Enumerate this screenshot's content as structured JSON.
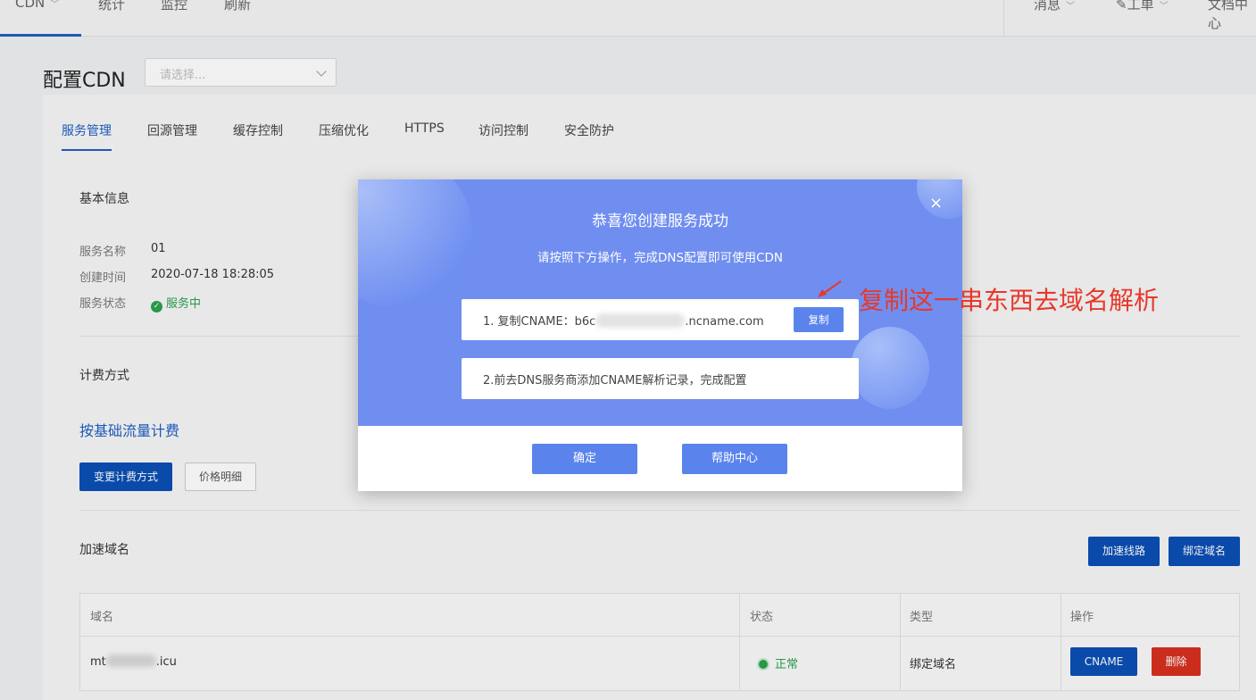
{
  "topnav": {
    "items": [
      "CDN",
      "统计",
      "监控",
      "刷新"
    ],
    "right_items": [
      "消息",
      "工单",
      "文档中心"
    ]
  },
  "header": {
    "title": "配置CDN",
    "select_placeholder": "请选择..."
  },
  "tabs": [
    "服务管理",
    "回源管理",
    "缓存控制",
    "压缩优化",
    "HTTPS",
    "访问控制",
    "安全防护"
  ],
  "basic_info": {
    "heading": "基本信息",
    "rows": [
      {
        "label": "服务名称",
        "value": "01"
      },
      {
        "label": "创建时间",
        "value": "2020-07-18 18:28:05"
      },
      {
        "label": "服务状态",
        "value": "服务中"
      }
    ]
  },
  "billing": {
    "heading": "计费方式",
    "mode": "按基础流量计费",
    "change_button": "变更计费方式",
    "price_button": "价格明细"
  },
  "domains": {
    "heading": "加速域名",
    "route_button": "加速线路",
    "bind_button": "绑定域名",
    "columns": [
      "域名",
      "状态",
      "类型",
      "操作"
    ],
    "rows": [
      {
        "domain_prefix": "mt",
        "domain_suffix": ".icu",
        "status": "正常",
        "type": "绑定域名",
        "cname_button": "CNAME",
        "delete_button": "删除"
      }
    ]
  },
  "modal": {
    "title": "恭喜您创建服务成功",
    "subtitle": "请按照下方操作，完成DNS配置即可使用CDN",
    "step1_prefix": "1. 复制CNAME：b6c",
    "step1_suffix": ".ncname.com",
    "copy_button": "复制",
    "step2": "2.前去DNS服务商添加CNAME解析记录，完成配置",
    "confirm_button": "确定",
    "help_button": "帮助中心",
    "close": "×"
  },
  "annotation": {
    "text": "复制这一串东西去域名解析",
    "color": "#e8382a"
  },
  "colors": {
    "primary": "#0b4fb5",
    "modal_blue": "#6f8ef0",
    "success": "#2ba24c",
    "danger": "#d8301f"
  }
}
